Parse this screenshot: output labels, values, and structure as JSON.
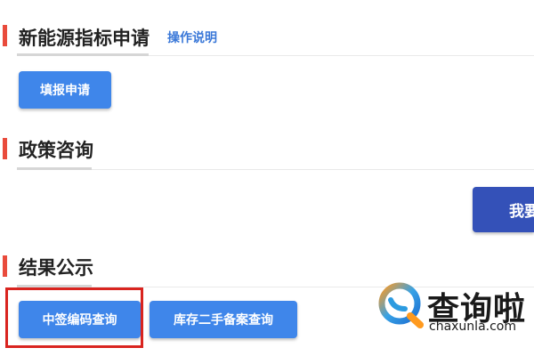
{
  "sections": {
    "new_energy": {
      "title": "新能源指标申请",
      "help_link": "操作说明",
      "button": "填报申请"
    },
    "policy": {
      "title": "政策咨询",
      "button": "我要"
    },
    "results": {
      "title": "结果公示",
      "buttons": [
        "中签编码查询",
        "库存二手备案查询"
      ]
    }
  },
  "watermark": {
    "name": "查询啦",
    "url": "chaxunla.com",
    "icon": "chaxunla-q-logo-icon"
  },
  "colors": {
    "accent": "#e94b3c",
    "primary_button": "#3f86ea",
    "dark_button": "#3451b8",
    "link": "#3a78d8",
    "highlight": "#d9241f"
  }
}
